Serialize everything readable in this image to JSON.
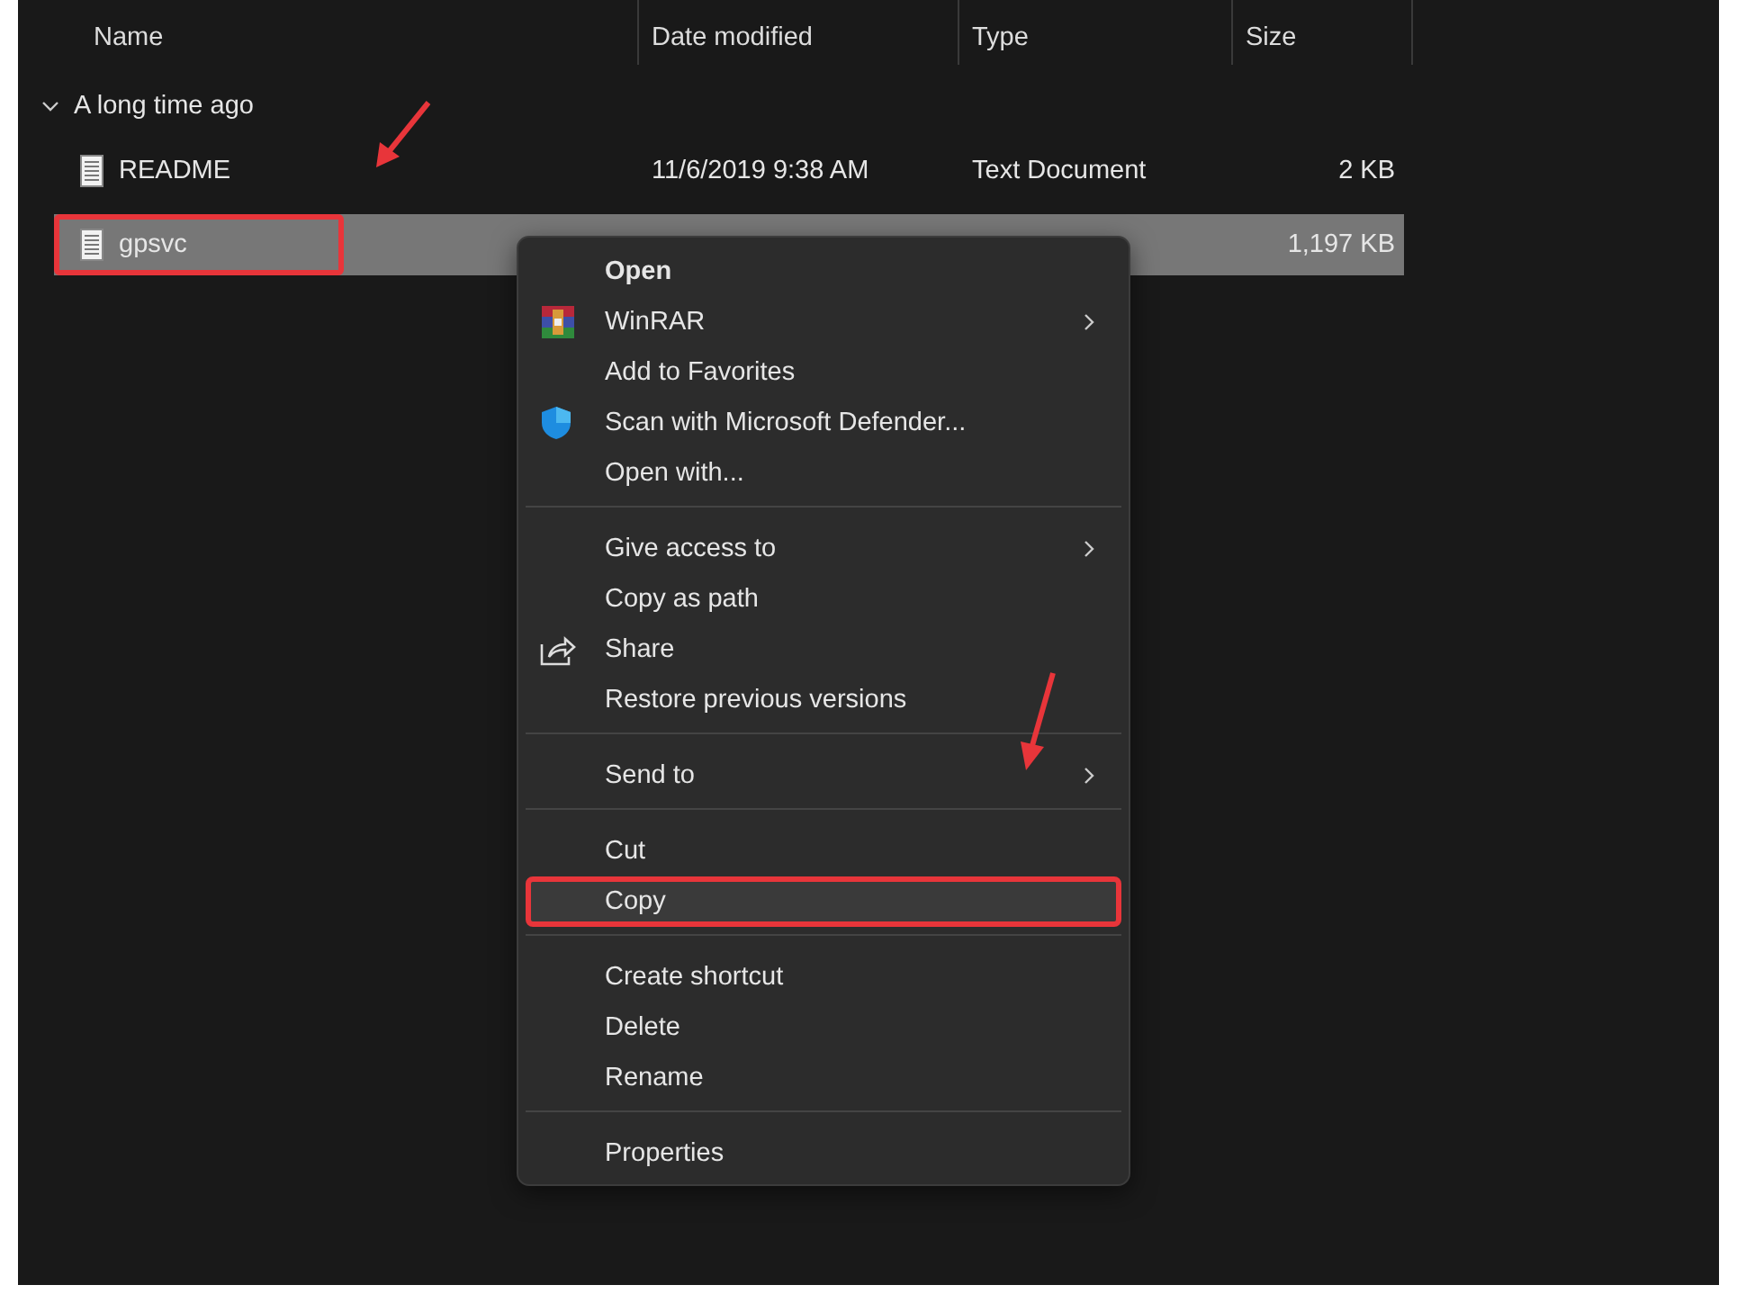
{
  "columns": [
    {
      "label": "Name"
    },
    {
      "label": "Date modified"
    },
    {
      "label": "Type"
    },
    {
      "label": "Size"
    }
  ],
  "group": {
    "label": "A long time ago",
    "expanded": true
  },
  "files": [
    {
      "name": "README",
      "date": "11/6/2019 9:38 AM",
      "type": "Text Document",
      "size": "2 KB",
      "selected": false,
      "annotated": false
    },
    {
      "name": "gpsvc",
      "size": "1,197 KB",
      "selected": true,
      "annotated": true
    }
  ],
  "context_menu": [
    {
      "kind": "item",
      "label": "Open",
      "bold": true,
      "submenu": false,
      "selected": false,
      "annotated": false
    },
    {
      "kind": "item",
      "label": "WinRAR",
      "bold": false,
      "submenu": true,
      "selected": false,
      "annotated": false
    },
    {
      "kind": "item",
      "label": "Add to Favorites",
      "bold": false,
      "submenu": false,
      "selected": false,
      "annotated": false
    },
    {
      "kind": "item",
      "label": "Scan with Microsoft Defender...",
      "bold": false,
      "submenu": false,
      "selected": false,
      "annotated": false
    },
    {
      "kind": "item",
      "label": "Open with...",
      "bold": false,
      "submenu": false,
      "selected": false,
      "annotated": false
    },
    {
      "kind": "separator"
    },
    {
      "kind": "item",
      "label": "Give access to",
      "bold": false,
      "submenu": true,
      "selected": false,
      "annotated": false
    },
    {
      "kind": "item",
      "label": "Copy as path",
      "bold": false,
      "submenu": false,
      "selected": false,
      "annotated": false
    },
    {
      "kind": "item",
      "label": "Share",
      "bold": false,
      "submenu": false,
      "selected": false,
      "annotated": false
    },
    {
      "kind": "item",
      "label": "Restore previous versions",
      "bold": false,
      "submenu": false,
      "selected": false,
      "annotated": false
    },
    {
      "kind": "separator"
    },
    {
      "kind": "item",
      "label": "Send to",
      "bold": false,
      "submenu": true,
      "selected": false,
      "annotated": false
    },
    {
      "kind": "separator"
    },
    {
      "kind": "item",
      "label": "Cut",
      "bold": false,
      "submenu": false,
      "selected": false,
      "annotated": false
    },
    {
      "kind": "item",
      "label": "Copy",
      "bold": false,
      "submenu": false,
      "selected": true,
      "annotated": true
    },
    {
      "kind": "separator"
    },
    {
      "kind": "item",
      "label": "Create shortcut",
      "bold": false,
      "submenu": false,
      "selected": false,
      "annotated": false
    },
    {
      "kind": "item",
      "label": "Delete",
      "bold": false,
      "submenu": false,
      "selected": false,
      "annotated": false
    },
    {
      "kind": "item",
      "label": "Rename",
      "bold": false,
      "submenu": false,
      "selected": false,
      "annotated": false
    },
    {
      "kind": "separator"
    },
    {
      "kind": "item",
      "label": "Properties",
      "bold": false,
      "submenu": false,
      "selected": false,
      "annotated": false
    }
  ]
}
